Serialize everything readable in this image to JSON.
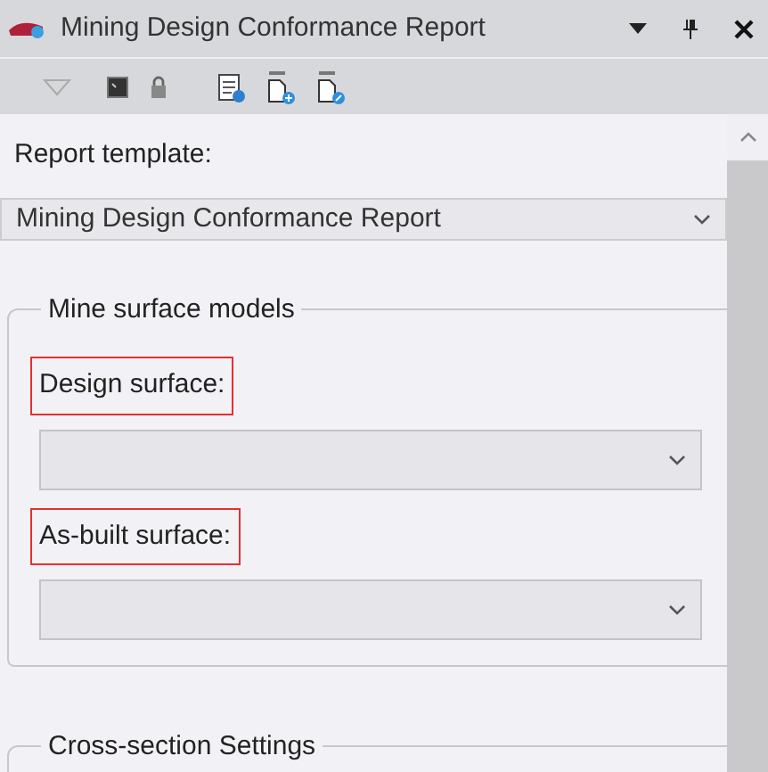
{
  "window": {
    "title": "Mining Design Conformance Report"
  },
  "report_template": {
    "label": "Report template:",
    "value": "Mining Design Conformance Report"
  },
  "groups": [
    {
      "title": "Mine surface models",
      "fields": [
        {
          "label": "Design surface:",
          "highlighted": true
        },
        {
          "label": "As-built surface:",
          "highlighted": true
        }
      ]
    },
    {
      "title": "Cross-section Settings"
    }
  ]
}
